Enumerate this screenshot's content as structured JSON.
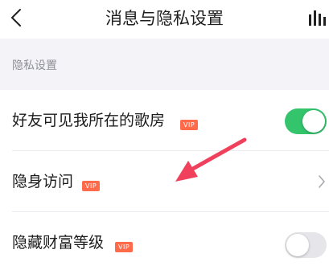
{
  "header": {
    "title": "消息与隐私设置",
    "back_icon": "chevron-left-icon",
    "right_icon": "bar-chart-icon"
  },
  "section": {
    "label": "隐私设置"
  },
  "rows": [
    {
      "label": "好友可见我所在的歌房",
      "badge": "VIP",
      "control": "toggle",
      "on": true
    },
    {
      "label": "隐身访问",
      "badge": "VIP",
      "control": "chevron"
    },
    {
      "label": "隐藏财富等级",
      "badge": "VIP",
      "control": "toggle",
      "on": false
    }
  ],
  "colors": {
    "accent_green": "#33c46c",
    "vip_badge": "#ff6a4b",
    "arrow_annotation": "#f0405c",
    "toggle_off": "#e6e6ea"
  },
  "annotation_icon": "pointer-arrow-icon"
}
